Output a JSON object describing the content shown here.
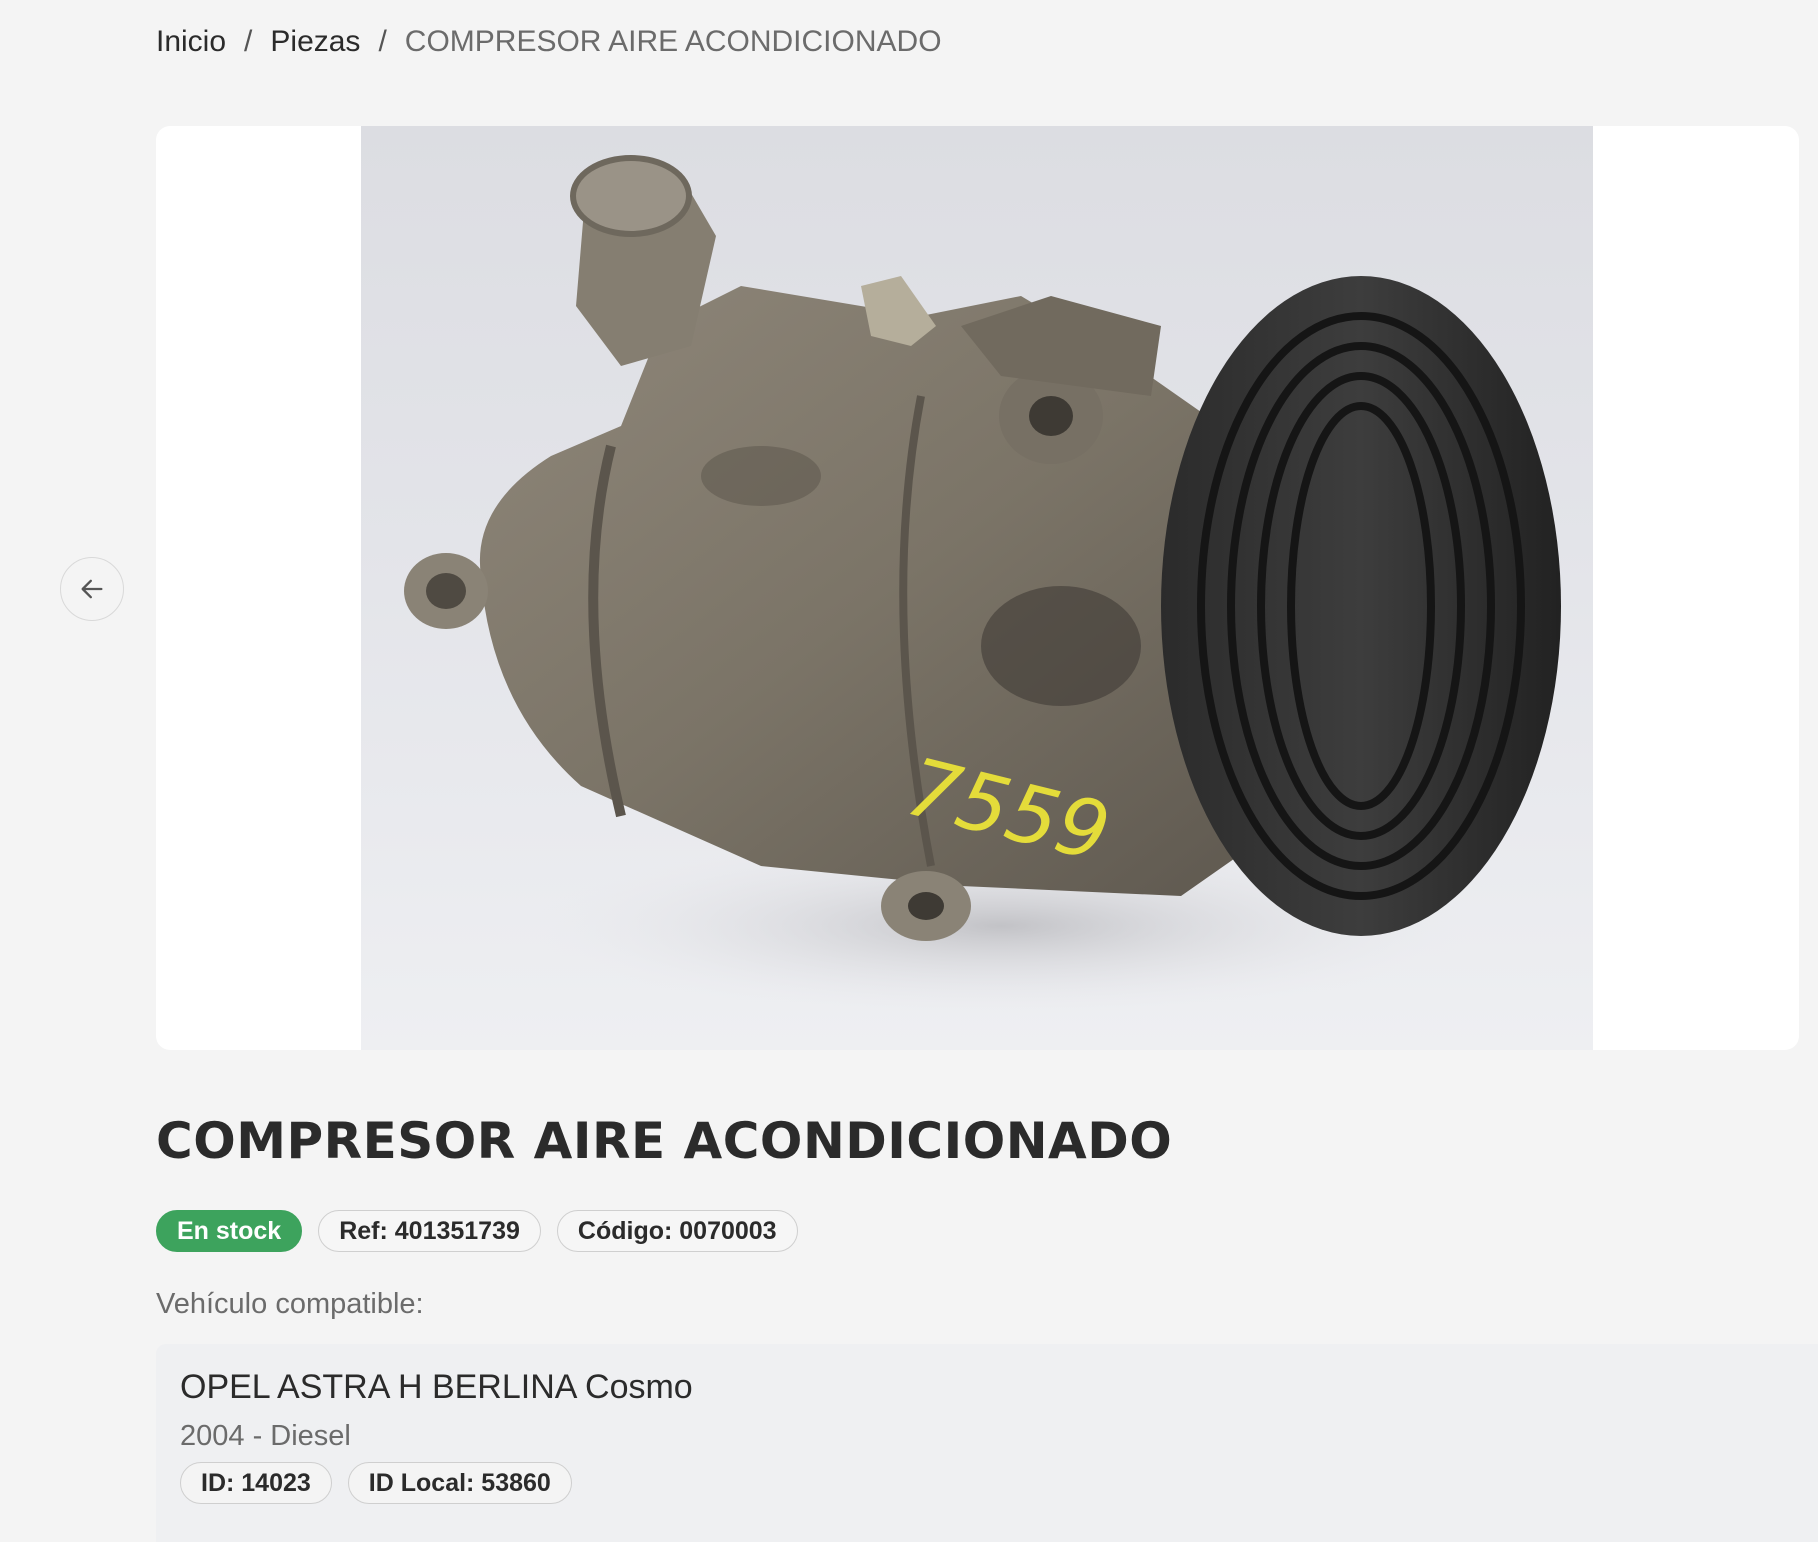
{
  "breadcrumb": {
    "home": "Inicio",
    "separator": "/",
    "section": "Piezas",
    "current": "COMPRESOR AIRE ACONDICIONADO"
  },
  "gallery": {
    "photo_label": "7559",
    "prev_icon": "arrow-left-icon"
  },
  "product": {
    "title": "COMPRESOR AIRE ACONDICIONADO",
    "stock": "En stock",
    "ref": "Ref: 401351739",
    "code": "Código: 0070003"
  },
  "compat": {
    "label": "Vehículo compatible:",
    "vehicle": {
      "name": "OPEL ASTRA H BERLINA Cosmo",
      "meta": "2004 - Diesel",
      "id": "ID: 14023",
      "local_id": "ID Local: 53860"
    }
  },
  "colors": {
    "stock_badge": "#3da35d",
    "background": "#f4f4f4"
  }
}
